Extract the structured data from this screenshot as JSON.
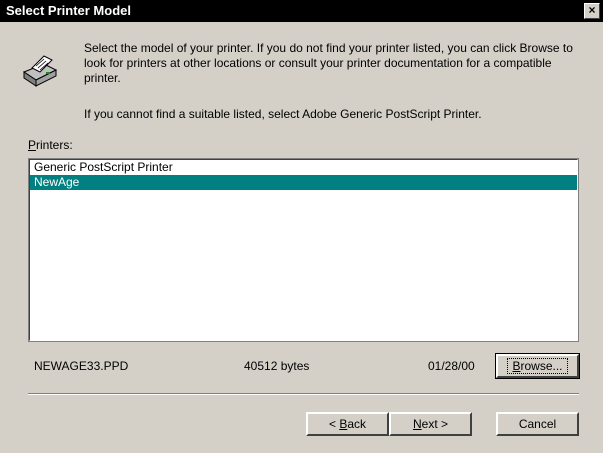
{
  "window": {
    "title": "Select Printer Model",
    "close_label": "×"
  },
  "intro": {
    "line1": "Select the model of your printer. If you do not find your printer listed, you can click Browse to look for printers at other locations or consult your printer documentation for a compatible printer.",
    "line2": "If you cannot find a suitable listed, select Adobe Generic PostScript Printer."
  },
  "printers": {
    "label_prefix": "P",
    "label_rest": "rinters:",
    "items": [
      {
        "label": "Generic PostScript Printer",
        "selected": false
      },
      {
        "label": "NewAge",
        "selected": true
      }
    ]
  },
  "file_info": {
    "filename": "NEWAGE33.PPD",
    "size": "40512 bytes",
    "date": "01/28/00"
  },
  "buttons": {
    "browse_prefix": "B",
    "browse_rest": "rowse...",
    "back_prefix": "< ",
    "back_accel": "B",
    "back_rest": "ack",
    "next_accel": "N",
    "next_rest": "ext >",
    "cancel": "Cancel"
  },
  "colors": {
    "selection": "#008080",
    "face": "#d4d0c8",
    "titlebar": "#000000"
  },
  "icons": {
    "printer": "printer-icon",
    "close": "close-icon"
  }
}
